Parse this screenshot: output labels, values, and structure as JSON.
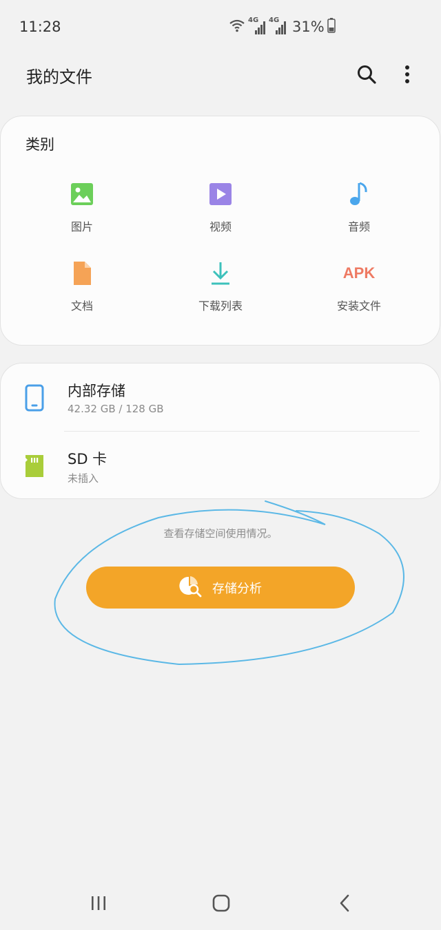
{
  "status_bar": {
    "time": "11:28",
    "network_left": "4G",
    "network_right": "4G",
    "battery": "31%",
    "icons": [
      "wifi-icon",
      "signal-icon",
      "signal-icon",
      "battery-icon"
    ]
  },
  "app_bar": {
    "title": "我的文件",
    "icons": [
      "search-icon",
      "more-vert-icon"
    ]
  },
  "categories": {
    "title": "类别",
    "items": [
      {
        "label": "图片",
        "icon": "image-icon",
        "color": "#6ccf5a"
      },
      {
        "label": "视频",
        "icon": "video-icon",
        "color": "#9a84e6"
      },
      {
        "label": "音频",
        "icon": "music-note-icon",
        "color": "#4aa6ec"
      },
      {
        "label": "文档",
        "icon": "document-icon",
        "color": "#f5a356"
      },
      {
        "label": "下载列表",
        "icon": "download-icon",
        "color": "#3cc1bb"
      },
      {
        "label": "安装文件",
        "icon": "apk-icon",
        "icon_text": "APK",
        "color": "#ee7a63"
      }
    ]
  },
  "storage": {
    "items": [
      {
        "name": "内部存储",
        "detail": "42.32 GB / 128 GB",
        "icon": "phone-icon",
        "color": "#4a9fe8"
      },
      {
        "name": "SD 卡",
        "detail": "未插入",
        "icon": "sd-card-icon",
        "color": "#a9cd3a"
      }
    ]
  },
  "analysis": {
    "hint": "查看存储空间使用情况。",
    "button_label": "存储分析",
    "button_color": "#f3a528",
    "icon": "storage-analysis-icon"
  },
  "annotation": {
    "color": "#5bb8e6"
  },
  "nav_bar": {
    "icons": [
      "recent-apps-icon",
      "home-icon",
      "back-icon"
    ]
  }
}
